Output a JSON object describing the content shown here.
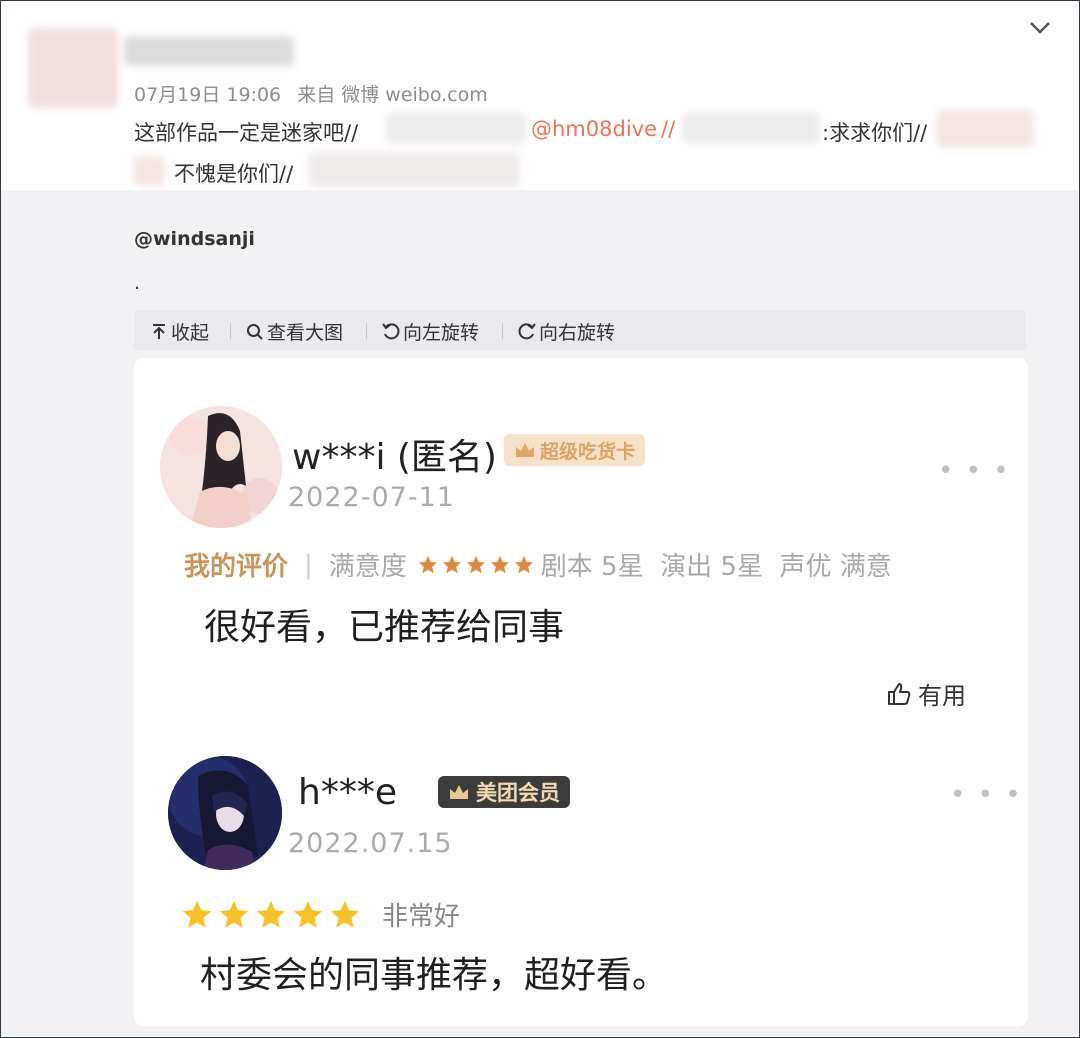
{
  "post": {
    "meta": {
      "date": "07月19日 19:06",
      "source": "来自 微博 weibo.com"
    },
    "text": {
      "part1": "这部作品一定是迷家吧//",
      "mention1": "@hm08dive",
      "sep1": " //",
      "part2": ":求求你们//",
      "part3": "不愧是你们//"
    },
    "icons": {
      "collapse": "chevron-down-icon"
    }
  },
  "repost": {
    "user": "@windsanji",
    "body": "."
  },
  "toolbar": {
    "collapse": "收起",
    "view_large": "查看大图",
    "rotate_left": "向左旋转",
    "rotate_right": "向右旋转"
  },
  "reviews": [
    {
      "username": "w***i (匿名)",
      "badge": "超级吃货卡",
      "date": "2022-07-11",
      "my_rating_label": "我的评价",
      "satisfaction_label": "满意度",
      "stars": 5,
      "details": "剧本 5星  演出 5星  声优 满意",
      "text": "很好看，已推荐给同事",
      "useful_label": "有用"
    },
    {
      "username": "h***e",
      "badge": "美团会员",
      "date": "2022.07.15",
      "stars": 5,
      "rating_text": "非常好",
      "text": "村委会的同事推荐，超好看。"
    }
  ],
  "colors": {
    "mention": "#eb7350",
    "star_orange": "#e08a3c",
    "star_yellow": "#f7c229",
    "badge1_bg": "#f6e2c8",
    "badge1_text": "#d9a467",
    "badge2_bg": "#3c3c3c",
    "badge2_text": "#f2d9b0"
  }
}
